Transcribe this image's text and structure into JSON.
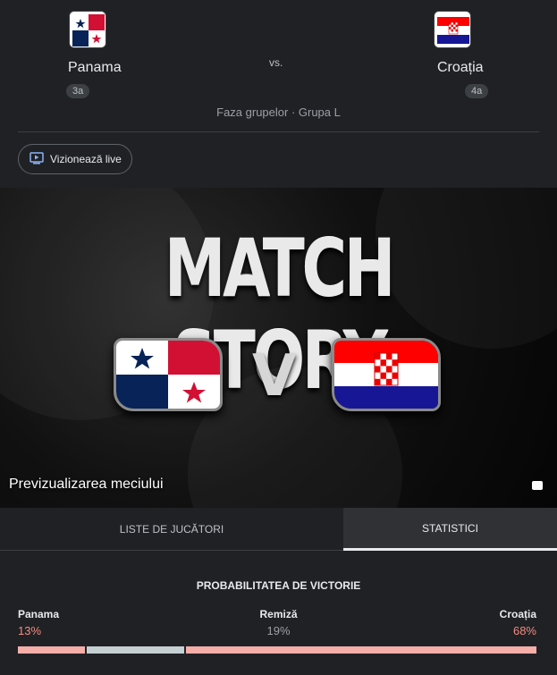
{
  "header": {
    "home": {
      "name": "Panama",
      "rank": "3a"
    },
    "away": {
      "name": "Croația",
      "rank": "4a"
    },
    "vs": "vs.",
    "stage": "Faza grupelor · Grupa L",
    "watch_label": "Vizionează live"
  },
  "video": {
    "title": "MATCH STORY",
    "versus": "V",
    "caption": "Previzualizarea meciului"
  },
  "tabs": [
    {
      "label": "LISTE DE JUCĂTORI",
      "active": false
    },
    {
      "label": "STATISTICI",
      "active": true
    }
  ],
  "win_probability": {
    "title": "PROBABILITATEA DE VICTORIE",
    "home": {
      "label": "Panama",
      "value": "13%",
      "fraction": 0.13
    },
    "draw": {
      "label": "Remiză",
      "value": "19%",
      "fraction": 0.19
    },
    "away": {
      "label": "Croația",
      "value": "68%",
      "fraction": 0.68
    }
  },
  "colors": {
    "home_bar": "#f6aea9",
    "draw_bar": "#c5d0d3",
    "away_bar": "#f6aea9",
    "home_pct": "#f28b82",
    "draw_pct": "#9aa0a6",
    "away_pct": "#f28b82"
  },
  "icons": {
    "watch": "tv-play-icon"
  }
}
